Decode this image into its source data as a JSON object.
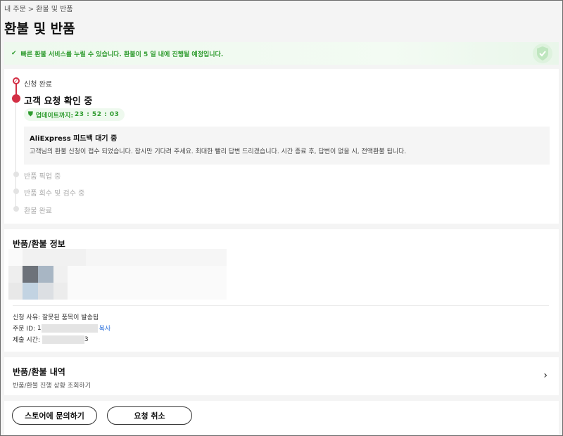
{
  "breadcrumb": {
    "parent": "내 주문",
    "separator": ">",
    "current": "환불 및 반품"
  },
  "page_title": "환불 및 반품",
  "banner": {
    "message": "빠른 환불 서비스를 누릴 수 있습니다. 환불이 5 일 내에 진행될 예정입니다.",
    "icon": "check-icon",
    "color": "#2e9b2e"
  },
  "timeline": {
    "steps": [
      {
        "label": "신청 완료",
        "state": "done"
      },
      {
        "label": "고객 요청 확인 중",
        "state": "active"
      },
      {
        "label": "반품 픽업 중",
        "state": "pending"
      },
      {
        "label": "반품 회수 및 검수 중",
        "state": "pending"
      },
      {
        "label": "환불 완료",
        "state": "pending"
      }
    ],
    "countdown_label": "업데이트까지:",
    "countdown_time": "23 : 52 : 03",
    "notice_title": "AliExpress 피드백 대기 중",
    "notice_body": "고객님의 환불 신청이 접수 되었습니다. 잠시만 기다려 주세요. 최대한 빨리 답변 드리겠습니다. 시간 종료 후, 답변이 없을 시, 전액환불 됩니다.",
    "accent": "#d32f45"
  },
  "refund_info": {
    "title": "반품/환불 정보",
    "reason_label": "신청 사유:",
    "reason_value": "잘못된 품목이 발송됨",
    "order_id_label": "주문 ID:",
    "order_id_prefix": "1",
    "copy_label": "복사",
    "submitted_label": "제출 시간:",
    "submitted_suffix": "3"
  },
  "history": {
    "title": "반품/환불 내역",
    "subtitle": "반품/환불 진행 상황 조회하기",
    "chevron": "›"
  },
  "actions": {
    "contact_store": "스토어에 문의하기",
    "cancel_request": "요청 취소"
  }
}
